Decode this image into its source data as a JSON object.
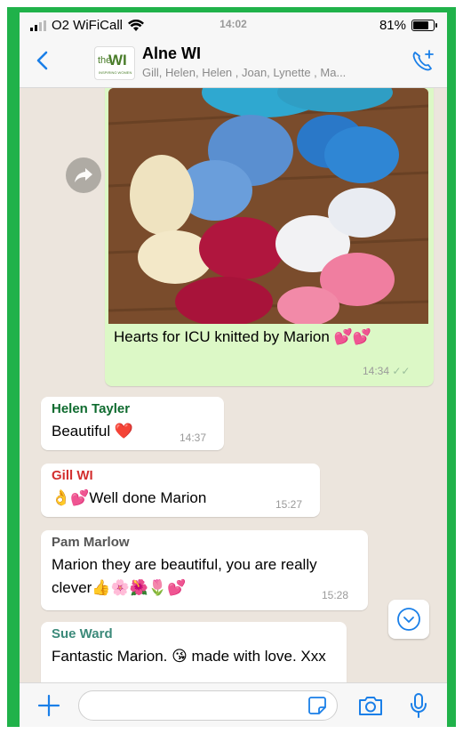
{
  "status": {
    "carrier": "O2 WiFiCall",
    "time": "14:02",
    "battery": "81%",
    "battery_level": 0.81
  },
  "header": {
    "title": "Alne WI",
    "members": "Gill, Helen, Helen , Joan, Lynette , Ma...",
    "logo_the": "the",
    "logo_wi": "WI",
    "logo_tag": "INSPIRING WOMEN"
  },
  "messages": {
    "m1": {
      "text": "Hearts for ICU knitted by Marion 💕💕",
      "time": "14:34",
      "ticks": "✓✓"
    },
    "m2": {
      "sender": "Helen  Tayler",
      "text": "Beautiful ❤️",
      "time": "14:37"
    },
    "m3": {
      "sender": "Gill WI",
      "text": "👌💕Well done Marion",
      "time": "15:27"
    },
    "m4": {
      "sender": "Pam Marlow",
      "text": "Marion they are beautiful, you are really clever👍🌸🌺🌷💕",
      "time": "15:28"
    },
    "m5": {
      "sender": "Sue Ward",
      "text": "Fantastic Marion. 😘 made with love. Xxx"
    }
  },
  "colors": {
    "frame": "#20b24a",
    "accent": "#1a7fe8",
    "outgoing": "#dcf8c6",
    "helen": "#0f6b2f",
    "gill": "#d32f2f",
    "pam": "#555555",
    "sue": "#3c8a7a"
  },
  "icons": [
    "signal-icon",
    "wifi-icon",
    "battery-icon",
    "back-icon",
    "add-call-icon",
    "forward-icon",
    "chevron-down-icon",
    "plus-icon",
    "sticker-icon",
    "camera-icon",
    "microphone-icon"
  ]
}
